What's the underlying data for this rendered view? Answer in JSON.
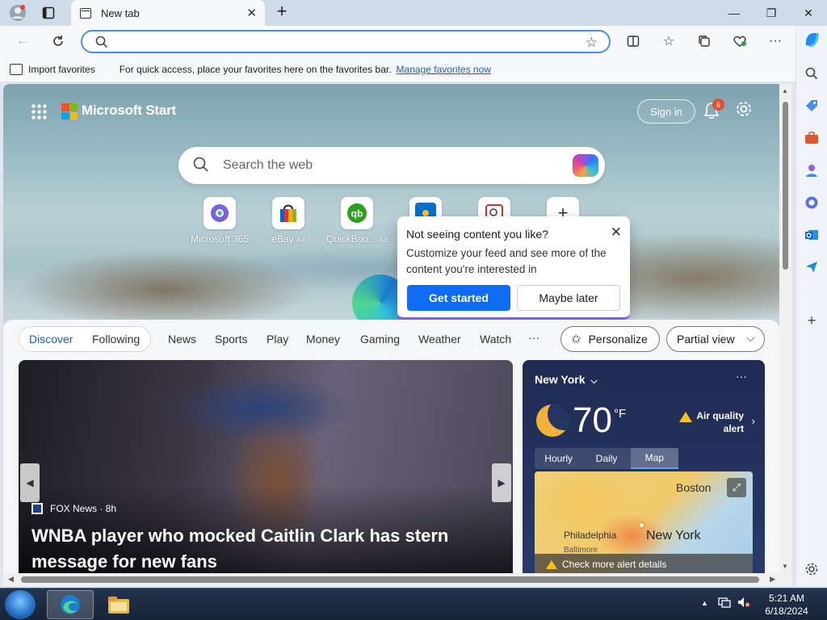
{
  "browser": {
    "tab_title": "New tab",
    "address_value": "",
    "favorites_bar": {
      "import_label": "Import favorites",
      "message": "For quick access, place your favorites here on the favorites bar.",
      "manage_link": "Manage favorites now"
    }
  },
  "start": {
    "brand": "Microsoft Start",
    "signin_label": "Sign in",
    "notification_count": "6",
    "search_placeholder": "Search the web",
    "shortcuts": [
      {
        "label": "Microsoft 365",
        "ad": ""
      },
      {
        "label": "eBay",
        "ad": "Ad"
      },
      {
        "label": "QuickBoo...",
        "ad": "Ad"
      }
    ]
  },
  "popup": {
    "title": "Not seeing content you like?",
    "body": "Customize your feed and see more of the content you're interested in",
    "primary": "Get started",
    "secondary": "Maybe later"
  },
  "feed_nav": {
    "discover": "Discover",
    "following": "Following",
    "items": [
      "News",
      "Sports",
      "Play",
      "Money",
      "Gaming",
      "Weather",
      "Watch"
    ],
    "more": "···",
    "personalize": "Personalize",
    "partial_view": "Partial view"
  },
  "news": {
    "source": "FOX News · 8h",
    "headline": "WNBA player who mocked Caitlin Clark has stern message for new fans"
  },
  "weather": {
    "city": "New York",
    "temp": "70",
    "unit": "°F",
    "alert_line1": "Air quality",
    "alert_line2": "alert",
    "tabs": [
      "Hourly",
      "Daily",
      "Map"
    ],
    "active_tab": "Map",
    "map_labels": {
      "boston": "Boston",
      "philadelphia": "Philadelphia",
      "baltimore": "Baltimore",
      "newyork": "New York"
    },
    "alert_details": "Check more alert details"
  },
  "taskbar": {
    "time": "5:21 AM",
    "date": "6/18/2024"
  },
  "colors": {
    "accent": "#0f6cf2",
    "link": "#1a5fb4",
    "badge": "#e54d2e"
  }
}
